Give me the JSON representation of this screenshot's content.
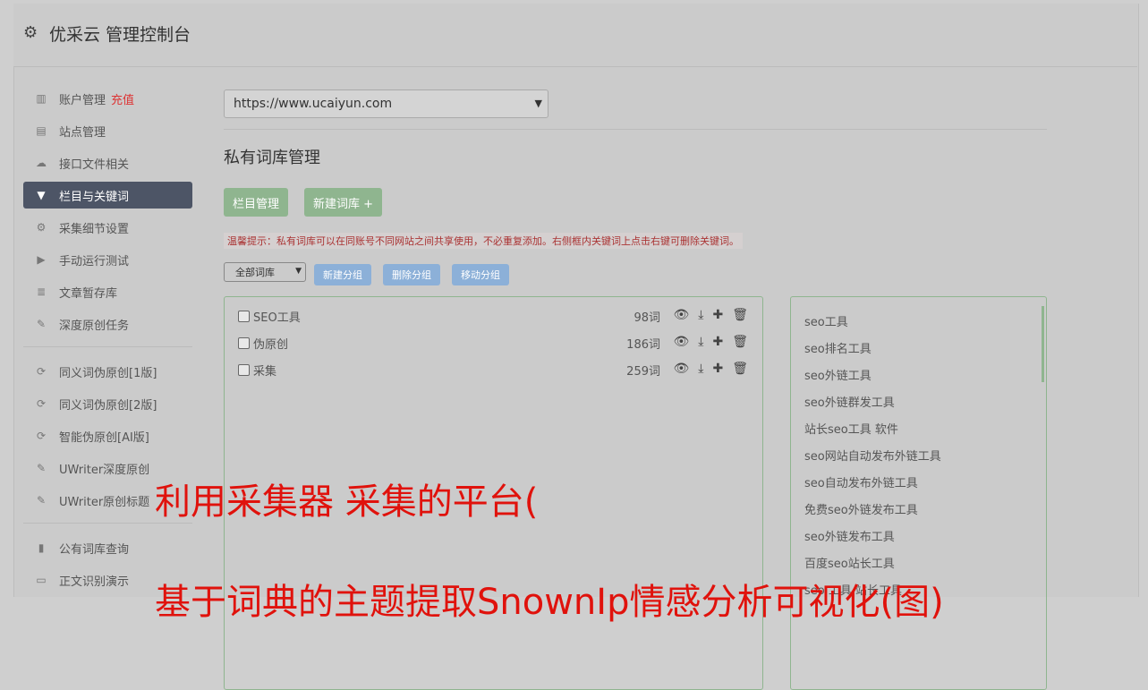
{
  "header": {
    "title": "优采云 管理控制台"
  },
  "sidebar": {
    "items": [
      {
        "label": "账户管理",
        "icon": "bar-chart-icon"
      },
      {
        "label": "站点管理",
        "icon": "server-icon"
      },
      {
        "label": "接口文件相关",
        "icon": "cloud-upload-icon"
      },
      {
        "label": "栏目与关键词",
        "icon": "filter-icon"
      },
      {
        "label": "采集细节设置",
        "icon": "cogs-icon"
      },
      {
        "label": "手动运行测试",
        "icon": "play-icon"
      },
      {
        "label": "文章暂存库",
        "icon": "database-icon"
      },
      {
        "label": "深度原创任务",
        "icon": "edit-icon"
      },
      {
        "label": "同义词伪原创[1版]",
        "icon": "refresh-icon"
      },
      {
        "label": "同义词伪原创[2版]",
        "icon": "refresh-icon"
      },
      {
        "label": "智能伪原创[AI版]",
        "icon": "refresh-icon"
      },
      {
        "label": "UWriter深度原创",
        "icon": "edit-icon"
      },
      {
        "label": "UWriter原创标题",
        "icon": "edit-icon"
      },
      {
        "label": "公有词库查询",
        "icon": "book-icon"
      },
      {
        "label": "正文识别演示",
        "icon": "monitor-icon"
      }
    ],
    "recharge_label": "充值"
  },
  "main": {
    "site_select": "https://www.ucaiyun.com",
    "page_title": "私有词库管理",
    "btn_column": "栏目管理",
    "btn_new_lib": "新建词库 +",
    "tip": "温馨提示：私有词库可以在同账号不同网站之间共享使用，不必重复添加。右侧框内关键词上点击右键可删除关键词。",
    "group_select": "全部词库",
    "btn_new_group": "新建分组",
    "btn_delete_group": "删除分组",
    "btn_move_group": "移动分组",
    "libraries": [
      {
        "name": "SEO工具",
        "count": "98词"
      },
      {
        "name": "伪原创",
        "count": "186词"
      },
      {
        "name": "采集",
        "count": "259词"
      }
    ],
    "keywords": [
      "seo工具",
      "seo排名工具",
      "seo外链工具",
      "seo外链群发工具",
      "站长seo工具 软件",
      "seo网站自动发布外链工具",
      "seo自动发布外链工具",
      "免费seo外链发布工具",
      "seo外链发布工具",
      "百度seo站长工具",
      "seo 工具 站长工具"
    ]
  },
  "overlay": {
    "line1": "利用采集器 采集的平台(",
    "line2": "基于词典的主题提取SnownIp情感分析可视化(图)"
  }
}
